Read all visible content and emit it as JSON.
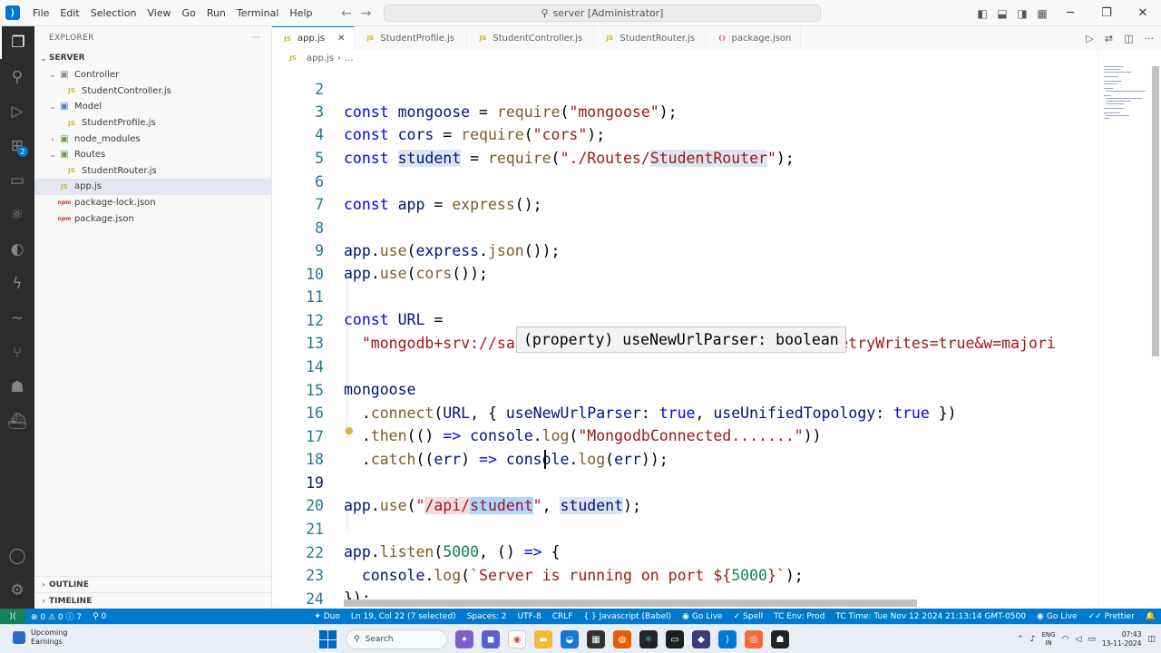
{
  "titlebar": {
    "logo_text": "⟩",
    "menu": [
      "File",
      "Edit",
      "Selection",
      "View",
      "Go",
      "Run",
      "Terminal",
      "Help"
    ],
    "search_text": "server [Administrator]"
  },
  "sidebar": {
    "header": "EXPLORER",
    "root": "SERVER",
    "tree": [
      {
        "label": "Controller",
        "type": "folder",
        "depth": 1
      },
      {
        "label": "StudentController.js",
        "type": "js",
        "depth": 2
      },
      {
        "label": "Model",
        "type": "folder",
        "depth": 1
      },
      {
        "label": "StudentProfile.js",
        "type": "js",
        "depth": 2
      },
      {
        "label": "node_modules",
        "type": "folder-closed",
        "depth": 1
      },
      {
        "label": "Routes",
        "type": "folder",
        "depth": 1
      },
      {
        "label": "StudentRouter.js",
        "type": "js",
        "depth": 2
      },
      {
        "label": "app.js",
        "type": "js",
        "depth": 1,
        "selected": true
      },
      {
        "label": "package-lock.json",
        "type": "json",
        "depth": 1
      },
      {
        "label": "package.json",
        "type": "json",
        "depth": 1
      }
    ],
    "outline": "OUTLINE",
    "timeline": "TIMELINE",
    "badge_count": "2"
  },
  "tabs": [
    {
      "label": "app.js",
      "icon": "JS",
      "active": true
    },
    {
      "label": "StudentProfile.js",
      "icon": "JS"
    },
    {
      "label": "StudentController.js",
      "icon": "JS"
    },
    {
      "label": "StudentRouter.js",
      "icon": "JS"
    },
    {
      "label": "package.json",
      "icon": "{}"
    }
  ],
  "breadcrumb": {
    "file": "app.js",
    "rest": "..."
  },
  "code": {
    "line2": "2",
    "line3": "3",
    "line4": "4",
    "line5": "5",
    "line6": "6",
    "line7": "7",
    "line8": "8",
    "line9": "9",
    "line10": "10",
    "line11": "11",
    "line12": "12",
    "line13": "13",
    "line14": "14",
    "line15": "15",
    "line16": "16",
    "line17": "17",
    "line18": "18",
    "line19": "19",
    "line20": "20",
    "line21": "21",
    "line22": "22",
    "line23": "23",
    "line24": "24",
    "mongo_url": "\"mongodb+srv://sa:sa123@cluster0.ednne.mongodb.net/?retryWrites=true&w=majori",
    "log_msg": "\"MongodbConnected.......\"",
    "route_path_a": "/api/",
    "route_path_b": "student",
    "server_msg": "`Server is running on port ${",
    "port": "5000"
  },
  "hover": "(property) useNewUrlParser: boolean",
  "statusbar": {
    "remote": "⟩⟨",
    "problems": "⊗ 0 ⚠ 0 ⓘ 7",
    "ports": "⚲ 0",
    "duo": "Duo",
    "position": "Ln 19, Col 22 (7 selected)",
    "spaces": "Spaces: 2",
    "encoding": "UTF-8",
    "eol": "CRLF",
    "language": "{ } Javascript (Babel)",
    "golive1": "Go Live",
    "spell": "Spell",
    "tc_env": "TC Env: Prod",
    "tc_time": "TC Time: Tue Nov 12 2024 21:13:14 GMT-0500",
    "golive2": "Go Live",
    "prettier": "Prettier"
  },
  "taskbar": {
    "widget_title": "Upcoming",
    "widget_sub": "Earnings",
    "search_placeholder": "Search",
    "lang_top": "ENG",
    "lang_bottom": "IN",
    "time": "07:43",
    "date": "13-11-2024"
  },
  "colors": {
    "accent": "#007acc",
    "remote": "#16825d",
    "activity_bar": "#2c2c2c"
  }
}
